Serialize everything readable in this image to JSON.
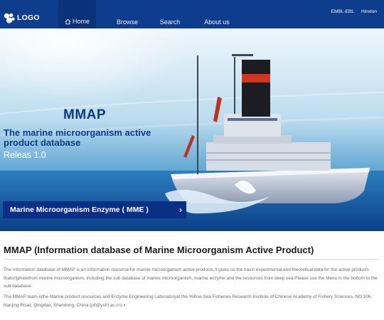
{
  "header": {
    "logo_text": "LOGO",
    "nav": [
      {
        "label": "Home",
        "active": true
      },
      {
        "label": "Browse"
      },
      {
        "label": "Search"
      },
      {
        "label": "About us"
      }
    ],
    "top_links": [
      "EMBL-EBL",
      "Hinxton"
    ]
  },
  "hero": {
    "title": "MMAP",
    "subtitle": "The marine microorganism active product database",
    "release": "Releas 1.0",
    "button_label": "Marine Microorganism Enzyme ( MME )"
  },
  "content": {
    "title": "MMAP (Information database of Marine Microorganism Active Product)",
    "paragraph1": "The Information database of MMAP is an information resource for marine microorganism active products.It gives us the basic experimental and theoretical data for the active products thatoriginatefrom marine microorganism, including the sub database of marine microorganism, marine enzyme and the resources from deep sea.Please use the Menu in the bottom to the sub database.",
    "paragraph2": "The MMAP team isthe Marine product resources and Enzyme Engineering Laboratoryat the Yellow Sea Fisheries Research Institute of Chinese Academy of Fishery Sciences, NO.106, Nanjing Road, Qingdao, Shandong, China (jxf@ysfri.ac.cn)"
  },
  "colors": {
    "header_bg": "#0d3d8c",
    "button_bg": "#0a2f86",
    "title_blue": "#0e3a86"
  }
}
